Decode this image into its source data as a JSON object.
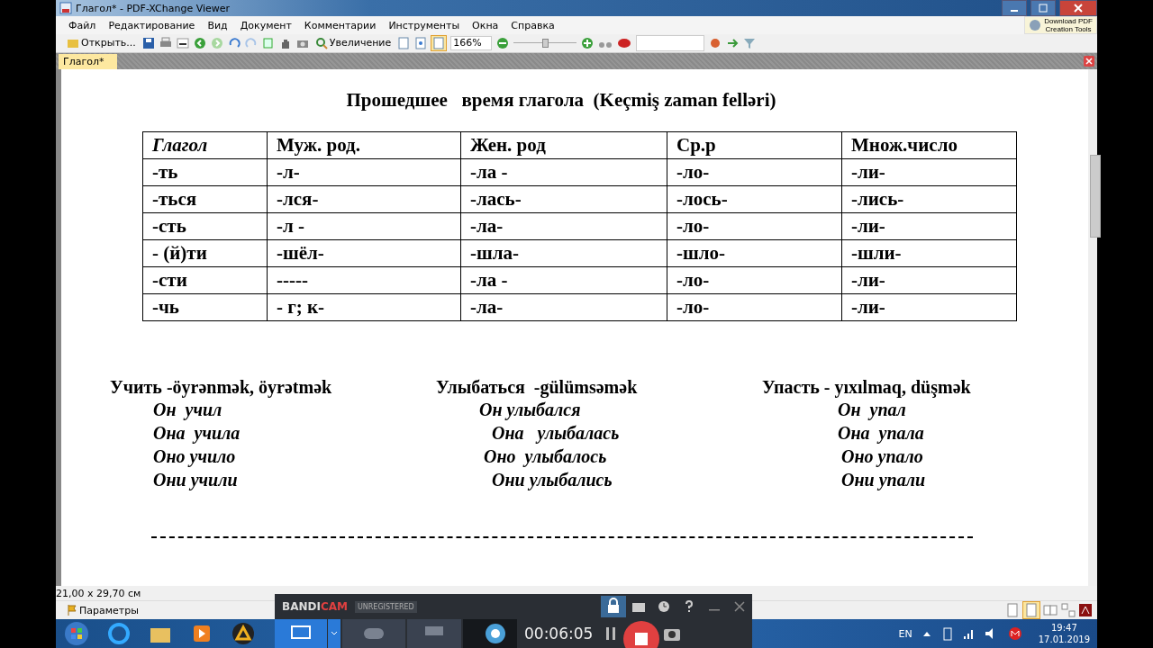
{
  "window": {
    "title": "Глагол* - PDF-XChange Viewer"
  },
  "menu": [
    "Файл",
    "Редактирование",
    "Вид",
    "Документ",
    "Комментарии",
    "Инструменты",
    "Окна",
    "Справка"
  ],
  "promo": {
    "line_1": "Download PDF",
    "line_2": "Creation Tools"
  },
  "toolbar": {
    "open_label": "Открыть...",
    "zoom_tool_label": "Увеличение",
    "zoom_value": "166%",
    "zoom_slider": {
      "level": 0.5
    }
  },
  "tabs": [
    {
      "label": "Глагол*",
      "selected": true
    }
  ],
  "document": {
    "title": "Прошедшее   время глагола  (Keçmiş zaman felləri)",
    "table": {
      "columns": [
        "Глагол",
        "Муж. род.",
        "Жен. род",
        "Ср.р",
        "Множ.число"
      ],
      "rows": [
        [
          "-ть",
          "-л-",
          "-ла -",
          "-ло-",
          "-ли-"
        ],
        [
          "-ться",
          "-лся-",
          "-лась-",
          "-лось-",
          "-лись-"
        ],
        [
          "-сть",
          "-л -",
          "-ла-",
          "-ло-",
          "-ли-"
        ],
        [
          "- (й)ти",
          "-шёл-",
          "-шла-",
          "-шло-",
          "-шли-"
        ],
        [
          "-сти",
          "-----",
          "-ла -",
          "-ло-",
          "-ли-"
        ],
        [
          "-чь",
          "- г; к-",
          "-ла-",
          "-ло-",
          "-ли-"
        ]
      ]
    },
    "examples": [
      {
        "heading": "Учить -öyrənmək, öyrətmək",
        "forms": [
          "Он  учил",
          "Она  учила",
          "Оно учило",
          "Они учили"
        ]
      },
      {
        "heading": "Улыбаться  -gülümsəmək",
        "forms": [
          "Он улыбался",
          "Она   улыбалась",
          "Оно  улыбалось",
          "Они улыбались"
        ]
      },
      {
        "heading": "Упасть - yıxılmaq, düşmək",
        "forms": [
          "Он  упал",
          "Она  упала",
          "Оно упало",
          "Они упали"
        ]
      }
    ]
  },
  "status": {
    "page_size": "21,00 x 29,70 см",
    "options_label": "Параметры"
  },
  "recorder": {
    "brand": [
      "BANDI",
      "CAM"
    ],
    "license": "UNREGISTERED",
    "timer": "00:06:05"
  },
  "taskbar": {
    "language": "EN",
    "time": "19:47",
    "date": "17.01.2019"
  }
}
